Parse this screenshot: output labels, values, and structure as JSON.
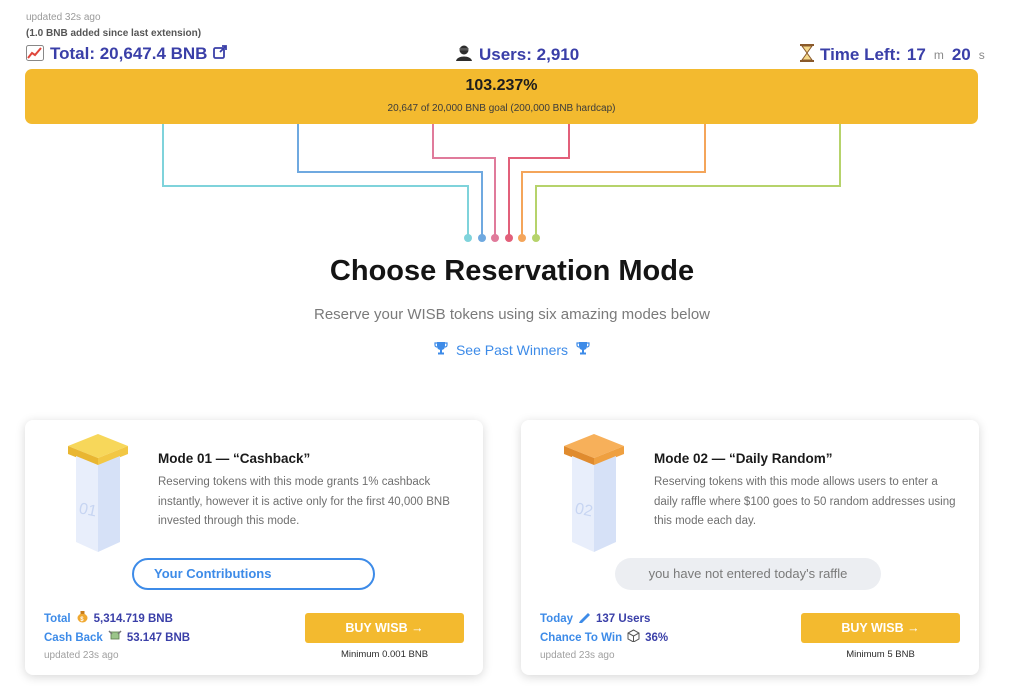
{
  "header": {
    "updated": "updated 32s ago",
    "extension_note": "(1.0 BNB added since last extension)",
    "total": {
      "icon": "chart-icon",
      "text": "Total: 20,647.4 BNB"
    },
    "users": {
      "icon": "user-icon",
      "text": "Users: 2,910"
    },
    "time_left": {
      "icon": "hourglass-icon",
      "label": "Time Left:",
      "minutes": "17",
      "minutes_unit": "m",
      "seconds": "20",
      "seconds_unit": "s"
    }
  },
  "progress": {
    "percent_text": "103.237%",
    "goal_text": "20,647 of 20,000 BNB goal (200,000 BNB hardcap)",
    "fill_percent": 100,
    "color": "#f3ba2f"
  },
  "wire_colors": [
    "#7fd3db",
    "#6fa9e0",
    "#e07b9b",
    "#e2607a",
    "#f4a55a",
    "#b6d36b"
  ],
  "main": {
    "heading": "Choose Reservation Mode",
    "subheading": "Reserve your WISB tokens using six amazing modes below",
    "past_winners": "See Past Winners"
  },
  "modes": [
    {
      "number": "01",
      "title": "Mode 01 — “Cashback”",
      "description": "Reserving tokens with this mode grants 1% cashback instantly, however it is active only for the first 40,000 BNB invested through this mode.",
      "action_label": "Your Contributions",
      "stats": [
        {
          "label": "Total",
          "icon": "money-bag-icon",
          "value": "5,314.719 BNB"
        },
        {
          "label": "Cash Back",
          "icon": "money-wings-icon",
          "value": "53.147 BNB"
        }
      ],
      "updated": "updated 23s ago",
      "buy_label": "BUY WISB →",
      "minimum": "Minimum 0.001 BNB"
    },
    {
      "number": "02",
      "title": "Mode 02 — “Daily Random”",
      "description": "Reserving tokens with this mode allows users to enter a daily raffle where $100 goes to 50 random addresses using this mode each day.",
      "action_label": "you have not entered today's raffle",
      "stats": [
        {
          "label": "Today",
          "icon": "pencil-icon",
          "value": "137 Users"
        },
        {
          "label": "Chance To Win",
          "icon": "dice-icon",
          "value": "36%"
        }
      ],
      "updated": "updated 23s ago",
      "buy_label": "BUY WISB →",
      "minimum": "Minimum 5 BNB"
    }
  ]
}
